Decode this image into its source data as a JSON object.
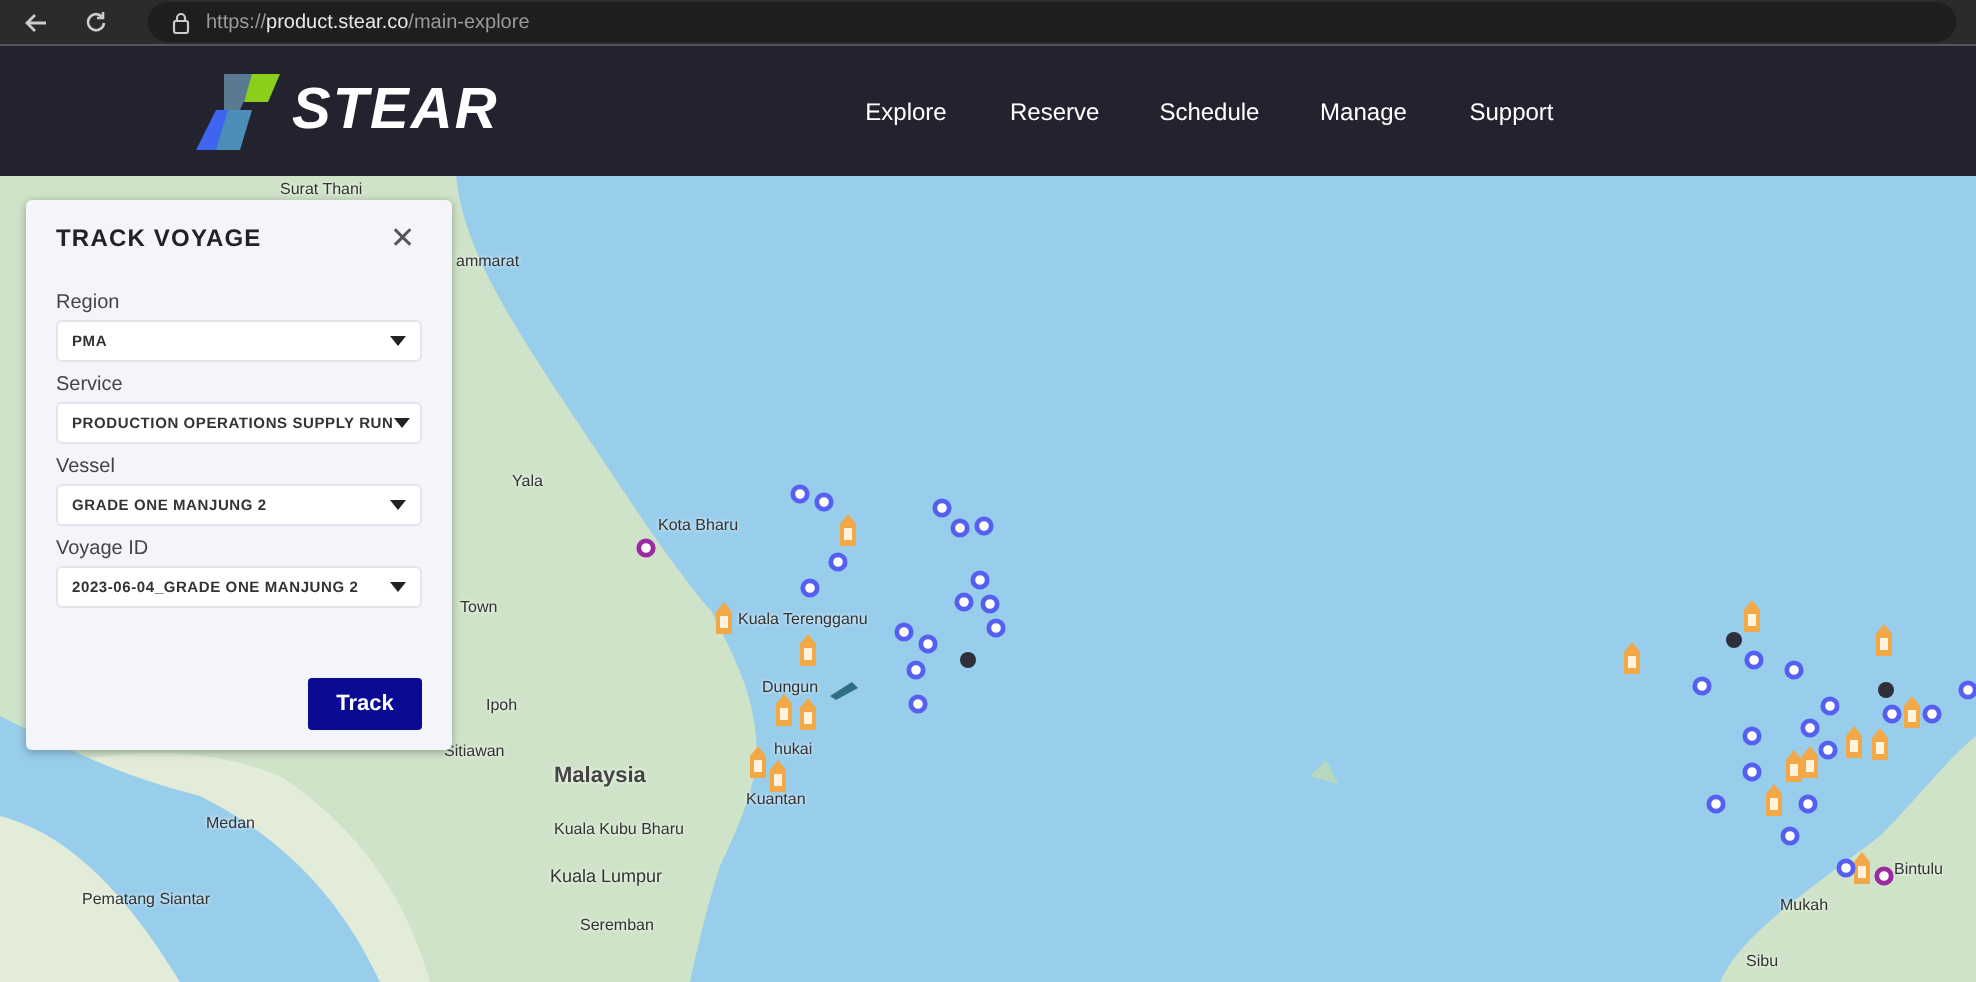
{
  "browser": {
    "url": "https://**product.stear.co**/main-explore"
  },
  "header": {
    "logo_text": "STEAR",
    "nav": [
      {
        "label": "Explore"
      },
      {
        "label": "Reserve"
      },
      {
        "label": "Schedule"
      },
      {
        "label": "Manage"
      },
      {
        "label": "Support"
      }
    ]
  },
  "panel": {
    "title": "TRACK VOYAGE",
    "close": "✕",
    "fields": [
      {
        "label": "Region",
        "value": "PMA"
      },
      {
        "label": "Service",
        "value": "PRODUCTION OPERATIONS SUPPLY RUN"
      },
      {
        "label": "Vessel",
        "value": "GRADE ONE MANJUNG 2"
      },
      {
        "label": "Voyage ID",
        "value": "2023-06-04_GRADE ONE MANJUNG 2"
      }
    ],
    "button": "Track"
  },
  "map": {
    "labels": [
      {
        "text": "Surat Thani",
        "kind": "city"
      },
      {
        "text": "ammarat",
        "kind": "city"
      },
      {
        "text": "Yala",
        "kind": "city"
      },
      {
        "text": "Kota Bharu",
        "kind": "city"
      },
      {
        "text": "Kuala Terengganu",
        "kind": "city"
      },
      {
        "text": "Dungun",
        "kind": "city"
      },
      {
        "text": "Town",
        "kind": "city"
      },
      {
        "text": "Ipoh",
        "kind": "city"
      },
      {
        "text": "Sitiawan",
        "kind": "city"
      },
      {
        "text": "Malaysia",
        "kind": "country"
      },
      {
        "text": "hukai",
        "kind": "city"
      },
      {
        "text": "Kuantan",
        "kind": "city"
      },
      {
        "text": "Kuala Kubu Bharu",
        "kind": "city"
      },
      {
        "text": "Kuala Lumpur",
        "kind": "capital"
      },
      {
        "text": "Seremban",
        "kind": "city"
      },
      {
        "text": "Medan",
        "kind": "city"
      },
      {
        "text": "Pematang Siantar",
        "kind": "city"
      },
      {
        "text": "Mukah",
        "kind": "city"
      },
      {
        "text": "Bintulu",
        "kind": "city"
      },
      {
        "text": "Sibu",
        "kind": "city"
      }
    ]
  }
}
